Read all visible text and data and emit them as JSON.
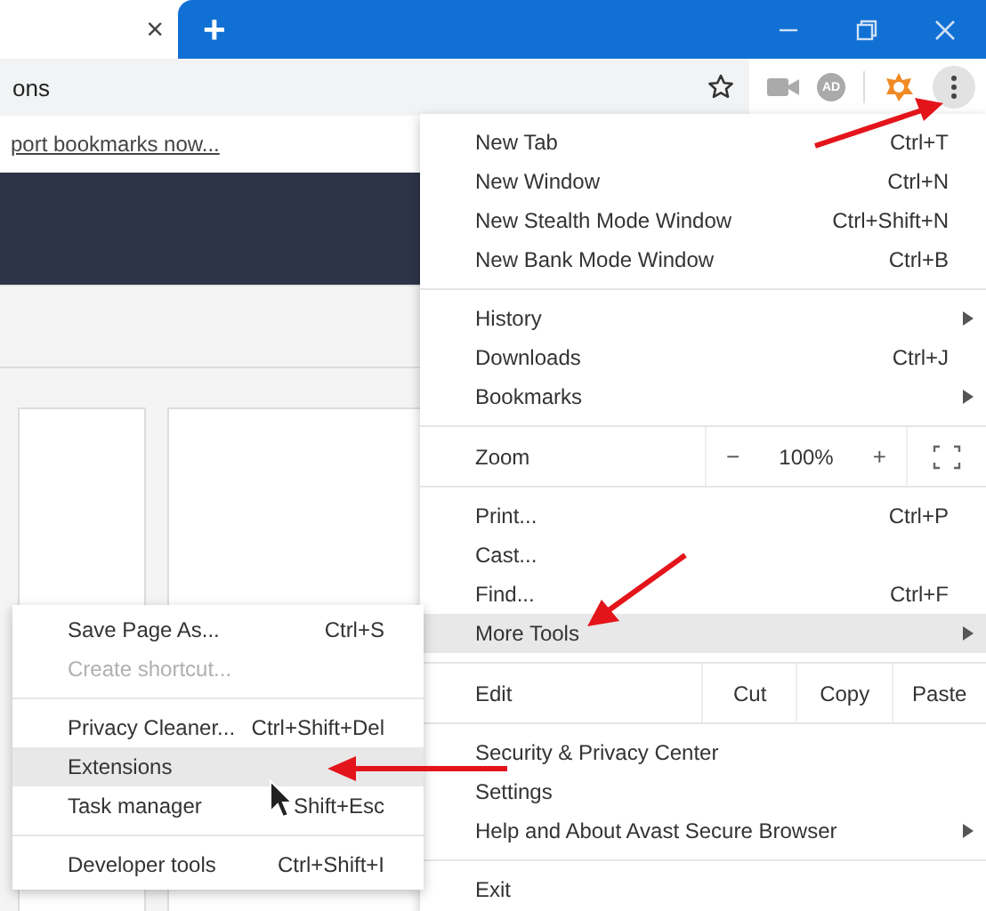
{
  "tab": {
    "close": "×"
  },
  "new_tab_button": "+",
  "address_bar": {
    "value": "ons"
  },
  "toolbar": {
    "ad_badge": "AD"
  },
  "bookmarks_prompt": {
    "link": "port bookmarks now..."
  },
  "main_menu": {
    "items": [
      {
        "kind": "item",
        "label": "New Tab",
        "shortcut": "Ctrl+T",
        "has_submenu": false,
        "selected": false
      },
      {
        "kind": "item",
        "label": "New Window",
        "shortcut": "Ctrl+N",
        "has_submenu": false,
        "selected": false
      },
      {
        "kind": "item",
        "label": "New Stealth Mode Window",
        "shortcut": "Ctrl+Shift+N",
        "has_submenu": false,
        "selected": false
      },
      {
        "kind": "item",
        "label": "New Bank Mode Window",
        "shortcut": "Ctrl+B",
        "has_submenu": false,
        "selected": false
      },
      {
        "kind": "divider"
      },
      {
        "kind": "item",
        "label": "History",
        "has_submenu": true,
        "selected": false
      },
      {
        "kind": "item",
        "label": "Downloads",
        "shortcut": "Ctrl+J",
        "has_submenu": false,
        "selected": false
      },
      {
        "kind": "item",
        "label": "Bookmarks",
        "has_submenu": true,
        "selected": false
      },
      {
        "kind": "zoom",
        "label": "Zoom",
        "minus": "−",
        "value": "100%",
        "plus": "+"
      },
      {
        "kind": "item",
        "label": "Print...",
        "shortcut": "Ctrl+P",
        "has_submenu": false,
        "selected": false
      },
      {
        "kind": "item",
        "label": "Cast...",
        "has_submenu": false,
        "selected": false
      },
      {
        "kind": "item",
        "label": "Find...",
        "shortcut": "Ctrl+F",
        "has_submenu": false,
        "selected": false
      },
      {
        "kind": "item",
        "label": "More Tools",
        "has_submenu": true,
        "selected": true
      },
      {
        "kind": "edit",
        "label": "Edit",
        "buttons": [
          "Cut",
          "Copy",
          "Paste"
        ]
      },
      {
        "kind": "item",
        "label": "Security & Privacy Center",
        "has_submenu": false,
        "selected": false
      },
      {
        "kind": "item",
        "label": "Settings",
        "has_submenu": false,
        "selected": false
      },
      {
        "kind": "item",
        "label": "Help and About Avast Secure Browser",
        "has_submenu": true,
        "selected": false
      },
      {
        "kind": "divider"
      },
      {
        "kind": "item",
        "label": "Exit",
        "has_submenu": false,
        "selected": false
      }
    ]
  },
  "more_tools_menu": {
    "items": [
      {
        "kind": "item",
        "label": "Save Page As...",
        "shortcut": "Ctrl+S",
        "disabled": false,
        "selected": false
      },
      {
        "kind": "item",
        "label": "Create shortcut...",
        "disabled": true,
        "selected": false
      },
      {
        "kind": "divider"
      },
      {
        "kind": "item",
        "label": "Privacy Cleaner...",
        "shortcut": "Ctrl+Shift+Del",
        "disabled": false,
        "selected": false
      },
      {
        "kind": "item",
        "label": "Extensions",
        "disabled": false,
        "selected": true
      },
      {
        "kind": "item",
        "label": "Task manager",
        "shortcut": "Shift+Esc",
        "disabled": false,
        "selected": false
      },
      {
        "kind": "divider"
      },
      {
        "kind": "item",
        "label": "Developer tools",
        "shortcut": "Ctrl+Shift+I",
        "disabled": false,
        "selected": false
      }
    ]
  }
}
